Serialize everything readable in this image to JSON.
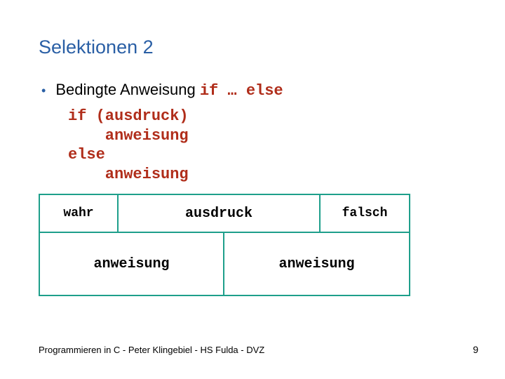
{
  "title": "Selektionen 2",
  "bullet": {
    "lead": "Bedingte Anweisung ",
    "code": "if … else"
  },
  "code": {
    "l1": "if (ausdruck)",
    "l2": "    anweisung",
    "l3": "else",
    "l4": "    anweisung"
  },
  "diagram": {
    "wahr": "wahr",
    "ausdruck": "ausdruck",
    "falsch": "falsch",
    "anweisung_l": "anweisung",
    "anweisung_r": "anweisung"
  },
  "footer": "Programmieren in C - Peter Klingebiel - HS Fulda - DVZ",
  "page": "9"
}
